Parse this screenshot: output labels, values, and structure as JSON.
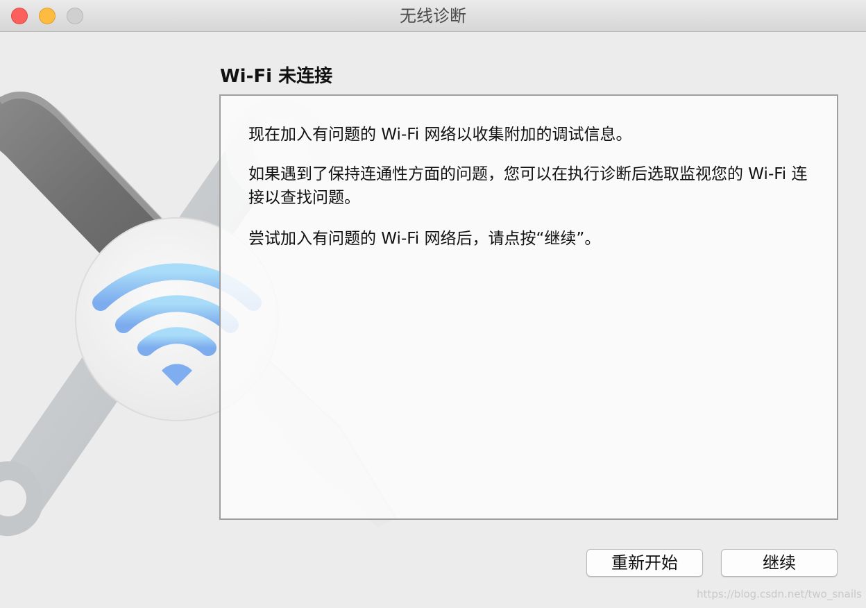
{
  "window": {
    "title": "无线诊断",
    "controls": [
      "close",
      "minimize",
      "zoom"
    ]
  },
  "illustration": {
    "icons": [
      "wrench-icon",
      "screwdriver-icon",
      "wifi-icon"
    ]
  },
  "main": {
    "heading": "Wi-Fi 未连接",
    "paragraphs": [
      "现在加入有问题的 Wi-Fi 网络以收集附加的调试信息。",
      "如果遇到了保持连通性方面的问题，您可以在执行诊断后选取监视您的 Wi-Fi 连接以查找问题。",
      "尝试加入有问题的 Wi-Fi 网络后，请点按“继续”。"
    ]
  },
  "buttons": {
    "restart": "重新开始",
    "continue": "继续"
  },
  "watermark": "https://blog.csdn.net/two_snails",
  "colors": {
    "close": "#fc605c",
    "minimize": "#fdbc40",
    "zoom": "#d0d0d0",
    "wifi": "#8ec9f2",
    "window_bg": "#ececec"
  }
}
